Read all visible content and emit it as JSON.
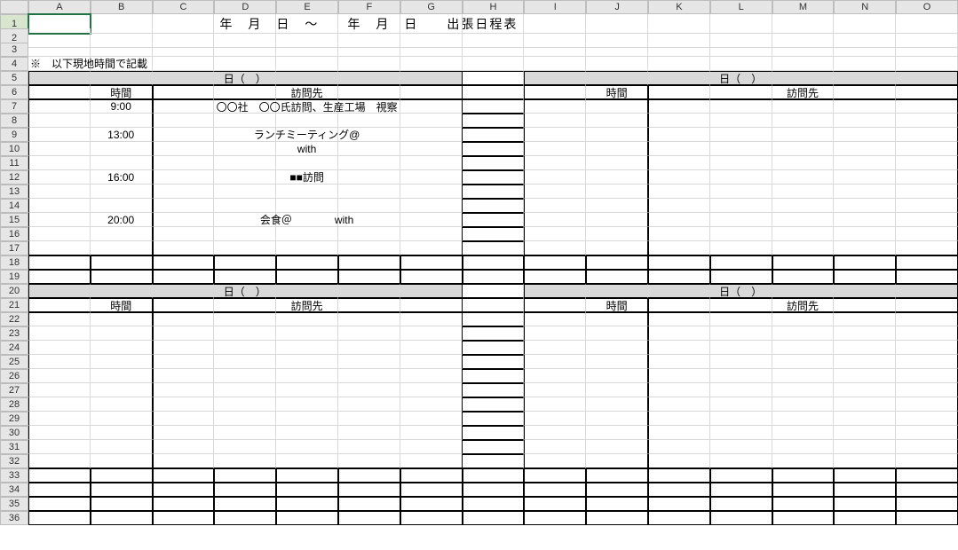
{
  "columns": [
    "A",
    "B",
    "C",
    "D",
    "E",
    "F",
    "G",
    "H",
    "I",
    "J",
    "K",
    "L",
    "M",
    "N",
    "O"
  ],
  "rows": 36,
  "selected_row": 1,
  "title": "年　月　日　～　　年　月　日　　出張日程表",
  "note": "※　以下現地時間で記載",
  "day_header": "日（　）",
  "col_time": "時間",
  "col_dest": "訪問先",
  "schedule": [
    {
      "time": "9:00",
      "dest": "〇〇社　〇〇氏訪問、生産工場　視察"
    },
    {
      "time": "13:00",
      "dest": "ランチミーティング@"
    },
    {
      "time": "",
      "dest": "with"
    },
    {
      "time": "16:00",
      "dest": "■■訪問"
    },
    {
      "time": "20:00",
      "dest": "会食＠　　　　with"
    }
  ]
}
